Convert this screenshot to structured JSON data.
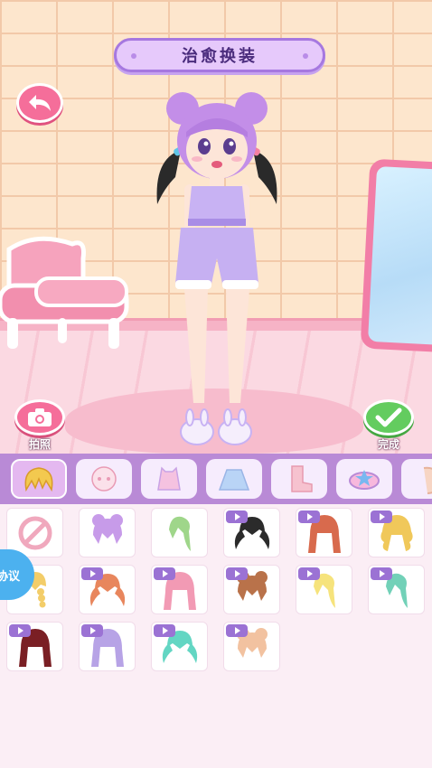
{
  "header": {
    "title": "治愈换装"
  },
  "actions": {
    "back_icon": "undo-arrow-icon",
    "photo_label": "拍照",
    "done_label": "完成"
  },
  "side": {
    "agreement_label": "协议"
  },
  "colors": {
    "accent_pink": "#f56e9a",
    "accent_purple": "#b98ad6",
    "done_green": "#63cc5f",
    "video_badge": "#9b72d4"
  },
  "tabs": [
    {
      "name": "hair",
      "icon": "hair-icon",
      "active": true
    },
    {
      "name": "face",
      "icon": "face-icon",
      "active": false
    },
    {
      "name": "top",
      "icon": "top-icon",
      "active": false
    },
    {
      "name": "skirt",
      "icon": "skirt-icon",
      "active": false
    },
    {
      "name": "shoes",
      "icon": "boot-icon",
      "active": false
    },
    {
      "name": "accessory",
      "icon": "hairclip-icon",
      "active": false
    },
    {
      "name": "ear",
      "icon": "ear-icon",
      "active": false
    }
  ],
  "items": [
    {
      "type": "none",
      "video": false
    },
    {
      "color": "#c79be9",
      "style": "buns",
      "video": false
    },
    {
      "color": "#9fd68a",
      "style": "side",
      "video": false
    },
    {
      "color": "#2b2b2b",
      "style": "pigtails",
      "video": true
    },
    {
      "color": "#d86a4d",
      "style": "long",
      "video": true
    },
    {
      "color": "#f0c85a",
      "style": "curly",
      "video": true
    },
    {
      "color": "#f3cd69",
      "style": "braid",
      "video": false
    },
    {
      "color": "#e8865d",
      "style": "pigtails",
      "video": true
    },
    {
      "color": "#f29ab4",
      "style": "long",
      "video": true
    },
    {
      "color": "#b9724a",
      "style": "buns",
      "video": true
    },
    {
      "color": "#f6e37c",
      "style": "side",
      "video": true
    },
    {
      "color": "#72d1b8",
      "style": "side",
      "video": true
    },
    {
      "color": "#7a1f24",
      "style": "long",
      "video": true
    },
    {
      "color": "#b7a3e6",
      "style": "long",
      "video": true
    },
    {
      "color": "#63d6c3",
      "style": "pigtails",
      "video": true
    },
    {
      "color": "#f2c2a0",
      "style": "buns",
      "video": true
    }
  ]
}
